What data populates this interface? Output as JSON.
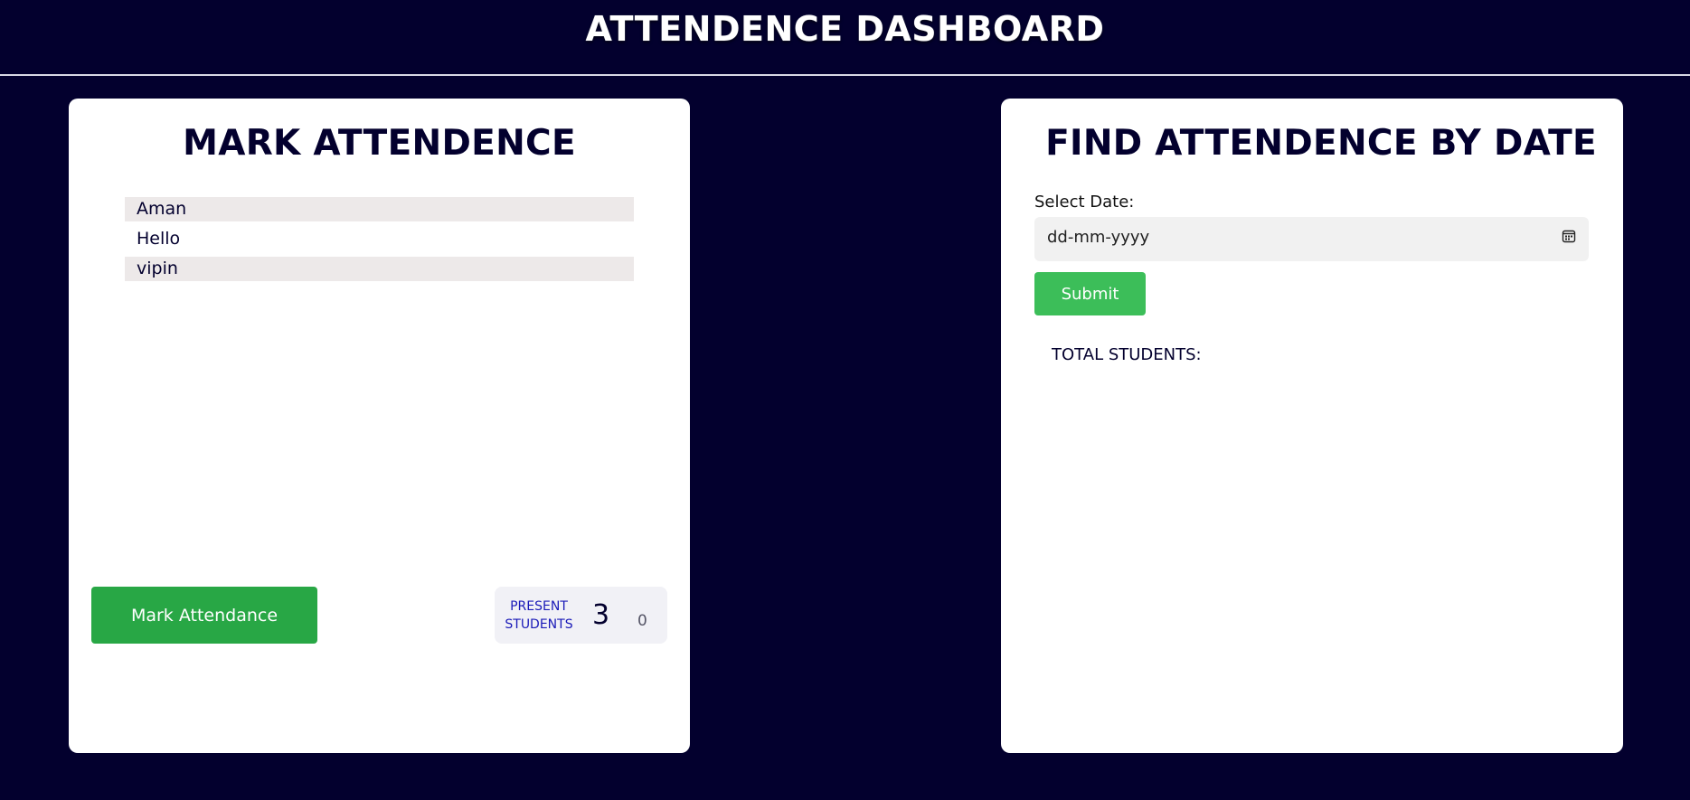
{
  "header": {
    "title": "ATTENDENCE DASHBOARD"
  },
  "mark_attendance": {
    "title": "MARK ATTENDENCE",
    "students": [
      "Aman",
      "Hello",
      "vipin"
    ],
    "button_label": "Mark Attendance",
    "present_label_line1": "PRESENT",
    "present_label_line2": "STUDENTS",
    "present_count": "3",
    "absent_count": "0"
  },
  "find_attendance": {
    "title": "FIND ATTENDENCE BY DATE",
    "date_label": "Select Date:",
    "date_placeholder": "dd-mm-yyyy",
    "submit_label": "Submit",
    "total_label": "TOTAL STUDENTS:"
  },
  "colors": {
    "background": "#03002e",
    "card": "#ffffff",
    "primary_button": "#28a745",
    "submit_button": "#3cbe59",
    "present_label": "#1a1ab8"
  },
  "icons": {
    "date_picker": "calendar-icon"
  }
}
